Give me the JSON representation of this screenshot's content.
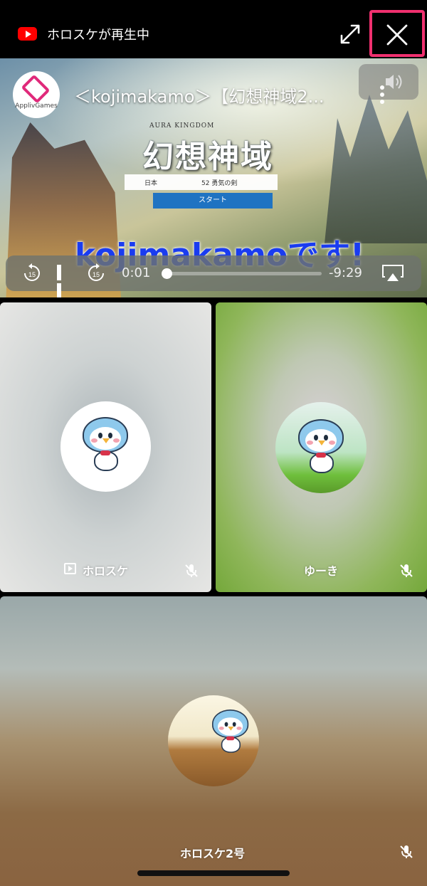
{
  "topbar": {
    "title": "ホロスケが再生中",
    "icons": {
      "app": "youtube-icon",
      "expand": "expand-icon",
      "close": "close-icon"
    },
    "close_highlight_color": "#f0306f"
  },
  "video": {
    "title": "＜kojimakamo＞【幻想神域2...",
    "channel_logo_text": "ApplivGames",
    "game_logo_sub": "AURA KINGDOM",
    "game_logo_main": "幻想神域",
    "game_bar": {
      "region": "日本",
      "server": "52 勇気の剣"
    },
    "start_label": "スタート",
    "caption": "kojimakamoです!",
    "controls": {
      "rewind_seconds": "15",
      "forward_seconds": "15",
      "current_time": "0:01",
      "remaining_time": "-9:29",
      "progress": 0.002
    }
  },
  "participants": [
    {
      "name": "ホロスケ",
      "sharing": true,
      "muted": true
    },
    {
      "name": "ゆーき",
      "sharing": false,
      "muted": true
    },
    {
      "name": "ホロスケ2号",
      "sharing": false,
      "muted": true
    }
  ],
  "colors": {
    "accent_close": "#f0306f",
    "youtube_red": "#ff0000",
    "caption_blue": "#1a3cf0",
    "start_button": "#1f73c2"
  }
}
